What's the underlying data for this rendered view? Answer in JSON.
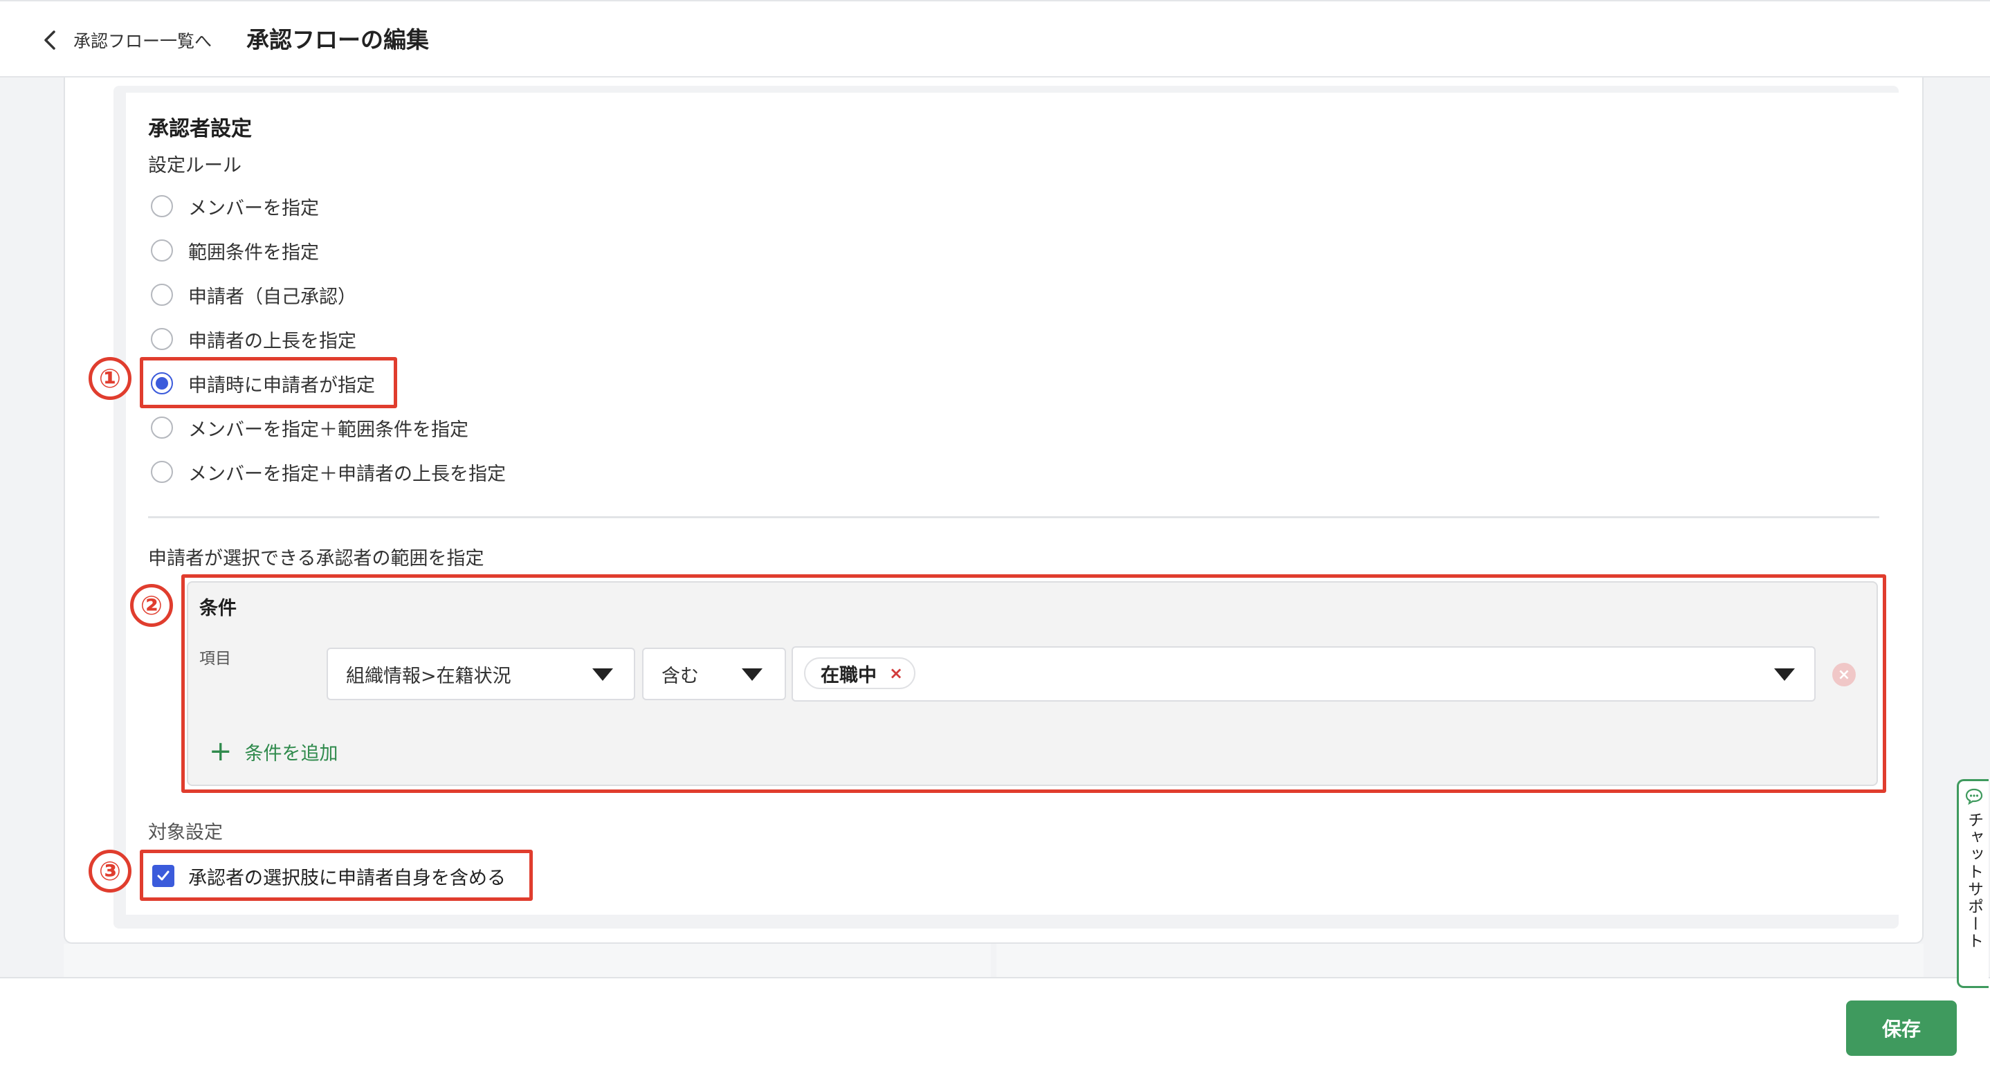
{
  "header": {
    "back_label": "承認フロー一覧へ",
    "title": "承認フローの編集"
  },
  "approver_settings": {
    "title": "承認者設定",
    "rule_label": "設定ルール",
    "options": [
      {
        "label": "メンバーを指定",
        "checked": false
      },
      {
        "label": "範囲条件を指定",
        "checked": false
      },
      {
        "label": "申請者（自己承認）",
        "checked": false
      },
      {
        "label": "申請者の上長を指定",
        "checked": false
      },
      {
        "label": "申請時に申請者が指定",
        "checked": true
      },
      {
        "label": "メンバーを指定＋範囲条件を指定",
        "checked": false
      },
      {
        "label": "メンバーを指定＋申請者の上長を指定",
        "checked": false
      }
    ]
  },
  "range": {
    "label": "申請者が選択できる承認者の範囲を指定",
    "condition_title": "条件",
    "item_label": "項目",
    "field_select": "組織情報>在籍状況",
    "operator_select": "含む",
    "value_tag": "在職中",
    "add_condition": "条件を追加"
  },
  "target": {
    "label": "対象設定",
    "checkbox_label": "承認者の選択肢に申請者自身を含める",
    "checked": true
  },
  "annotations": [
    "①",
    "②",
    "③"
  ],
  "footer": {
    "save_label": "保存"
  },
  "chat": {
    "label": "チャットサポート"
  },
  "colors": {
    "accent_blue": "#3b5bdb",
    "annotation_red": "#e03d2e",
    "primary_green": "#3f9a5e"
  }
}
